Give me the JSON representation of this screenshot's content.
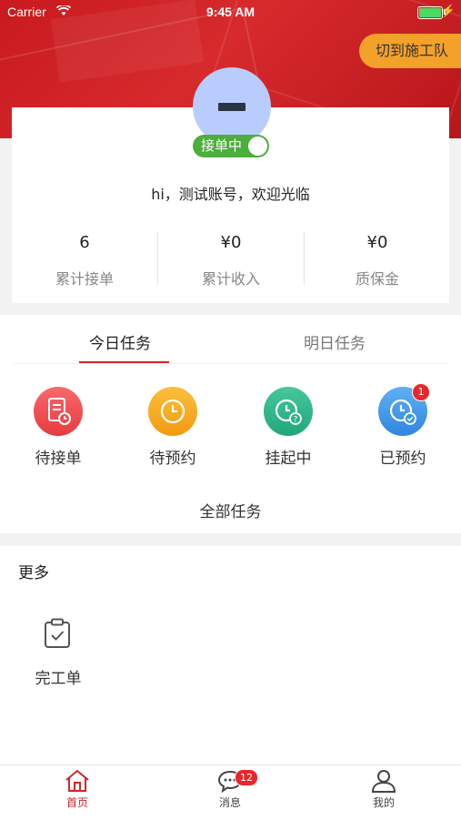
{
  "status_bar": {
    "carrier": "Carrier",
    "time": "9:45 AM"
  },
  "header": {
    "switch_team_label": "切到施工队"
  },
  "profile": {
    "status_label": "接单中",
    "status_on": true,
    "greeting": "hi，测试账号，欢迎光临",
    "stats": [
      {
        "value": "6",
        "label": "累计接单"
      },
      {
        "value": "¥0",
        "label": "累计收入"
      },
      {
        "value": "¥0",
        "label": "质保金"
      }
    ]
  },
  "tasks": {
    "tabs": [
      {
        "label": "今日任务",
        "active": true
      },
      {
        "label": "明日任务",
        "active": false
      }
    ],
    "items": [
      {
        "label": "待接单",
        "icon": "document-clock-icon",
        "color": "#ef4a4f"
      },
      {
        "label": "待预约",
        "icon": "clock-icon",
        "color": "#f4a41f"
      },
      {
        "label": "挂起中",
        "icon": "clock-question-icon",
        "color": "#2ab389"
      },
      {
        "label": "已预约",
        "icon": "clock-check-icon",
        "color": "#3a96e8",
        "badge": "1"
      }
    ],
    "all_label": "全部任务"
  },
  "more": {
    "title": "更多",
    "items": [
      {
        "label": "完工单",
        "icon": "clipboard-check-icon"
      }
    ]
  },
  "tabbar": {
    "items": [
      {
        "label": "首页",
        "icon": "home-icon",
        "active": true
      },
      {
        "label": "消息",
        "icon": "chat-icon",
        "badge": "12"
      },
      {
        "label": "我的",
        "icon": "user-icon"
      }
    ]
  },
  "colors": {
    "brand_red": "#d0262a",
    "accent_orange": "#f4a12a",
    "status_green": "#4cae3b"
  }
}
